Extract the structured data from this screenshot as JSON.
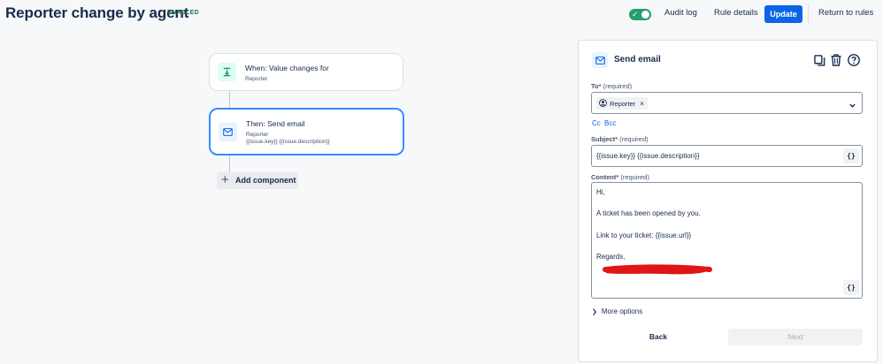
{
  "header": {
    "title": "Reporter change by agent",
    "status_badge": "ENABLED",
    "toggle_enabled": true,
    "audit_log_label": "Audit log",
    "rule_details_label": "Rule details",
    "update_label": "Update",
    "return_label": "Return to rules"
  },
  "flow": {
    "trigger": {
      "title": "When: Value changes for",
      "subtitle": "Reporter",
      "icon": "field-change-icon"
    },
    "action": {
      "title": "Then: Send email",
      "subtitle": "Reporter",
      "detail": "{{issue.key}} {{issue.description}}",
      "icon": "mail-icon"
    },
    "add_component_label": "Add component"
  },
  "panel": {
    "title": "Send email",
    "to": {
      "label": "To",
      "hint": "(required)",
      "chip": "Reporter"
    },
    "cc_label": "Cc",
    "bcc_label": "Bcc",
    "subject": {
      "label": "Subject",
      "hint": "(required)",
      "value": "{{issue.key}} {{issue.description}}"
    },
    "content": {
      "label": "Content",
      "hint": "(required)",
      "lines": [
        "Hi,",
        "A ticket has been opened by you.",
        "Link to your ticket: {{issue.url}}",
        "Regards,"
      ]
    },
    "smart_value_button": "{}",
    "more_options_label": "More options",
    "back_label": "Back",
    "next_label": "Next"
  },
  "colors": {
    "primary": "#0c66e4",
    "toggle_on": "#22a06b",
    "badge_text": "#216e4e",
    "selected_border": "#388bff",
    "redaction": "#e01515"
  }
}
